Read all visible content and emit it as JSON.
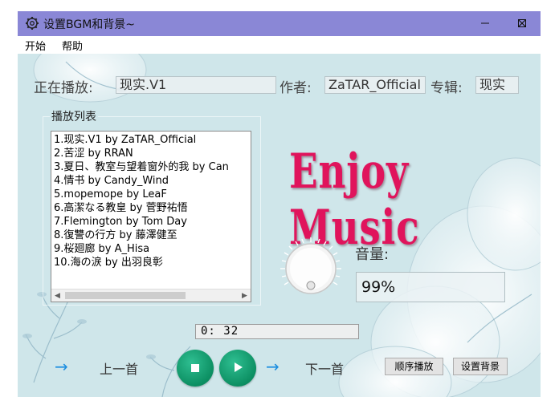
{
  "window": {
    "title": "设置BGM和背景~",
    "minimize_glyph": "–",
    "maximize_glyph": "☐",
    "close_glyph": "✕"
  },
  "menu": {
    "items": [
      "开始",
      "帮助"
    ]
  },
  "now_playing": {
    "playing_label": "正在播放:",
    "playing_value": "现实.V1",
    "author_label": "作者:",
    "author_value": "ZaTAR_Official",
    "album_label": "专辑:",
    "album_value": "现实"
  },
  "playlist": {
    "title": "播放列表",
    "items": [
      "1.现实.V1 by ZaTAR_Official",
      "2.苦涩 by RRAN",
      "3.夏日、教室与望着窗外的我 by Can",
      "4.情书 by Candy_Wind",
      "5.mopemope by LeaF",
      "6.高潔なる教皇 by 菅野祐悟",
      "7.Flemington by Tom Day",
      "8.復讐の行方 by 藤澤健至",
      "9.桜廻廊 by A_Hisa",
      "10.海の涙 by 出羽良彰"
    ],
    "scroll_left": "◀",
    "scroll_right": "▶"
  },
  "banner": "Enjoy Music",
  "volume": {
    "label": "音量:",
    "value": "99%"
  },
  "progress": {
    "time": "0: 32"
  },
  "controls": {
    "prev_arrow": "→",
    "prev_label": "上一首",
    "next_arrow": "→",
    "next_label": "下一首",
    "order_button": "顺序播放",
    "background_button": "设置背景"
  },
  "colors": {
    "titlebar": "#8a87d6",
    "content_bg": "#cfe6ea",
    "banner": "#e0145c",
    "play_buttons": "#0c8f62",
    "arrow": "#1e8fe0"
  },
  "icons": {
    "app": "gear-icon",
    "stop": "stop-icon",
    "play": "play-icon",
    "knob": "volume-knob-icon"
  }
}
